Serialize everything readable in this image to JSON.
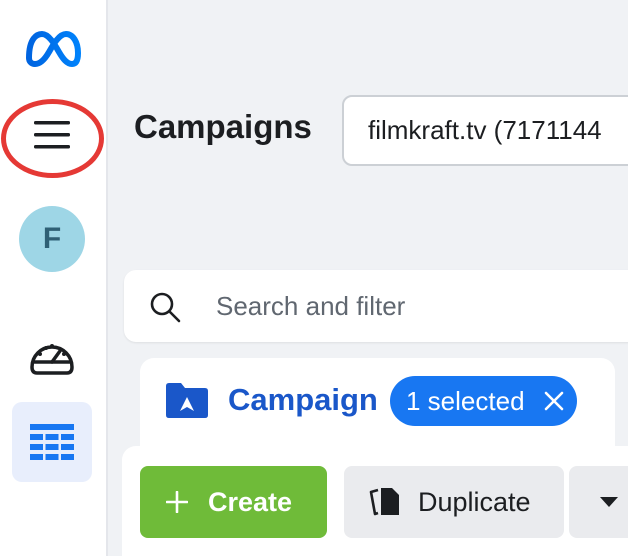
{
  "app": {
    "sidebar": {
      "avatar_initial": "F",
      "icons": [
        "meta-logo-icon",
        "menu-icon",
        "dashboard-gauge-icon",
        "table-grid-icon"
      ]
    },
    "header": {
      "title": "Campaigns",
      "account_selector": "filmkraft.tv (7171144"
    },
    "search": {
      "placeholder": "Search and filter"
    },
    "tabs": {
      "active_label": "Campaigns",
      "selected_count_label": "1 selected"
    },
    "toolbar": {
      "create_label": "Create",
      "duplicate_label": "Duplicate"
    },
    "colors": {
      "brand_blue": "#1877f2",
      "tab_blue": "#1a57c9",
      "create_green": "#6fbb39",
      "annotation_red": "#e53935"
    }
  }
}
